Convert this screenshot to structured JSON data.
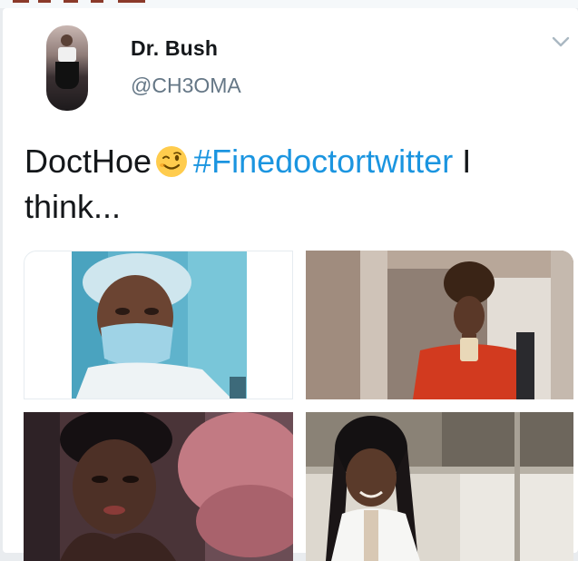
{
  "tweet": {
    "display_name": "Dr. Bush",
    "handle": "@CH3OMA",
    "text_before": "DoctHoe",
    "emoji": "winking-face-icon",
    "hashtag": "#Finedoctortwitter",
    "text_after": " I think..."
  },
  "media": {
    "photos": [
      "photo-nurse-cap-mask",
      "photo-red-top-selfie",
      "photo-afro-reclining",
      "photo-braids-lab-coat"
    ]
  },
  "colors": {
    "hashtag": "#1b95e0",
    "handle": "#657786",
    "text": "#14171a"
  }
}
